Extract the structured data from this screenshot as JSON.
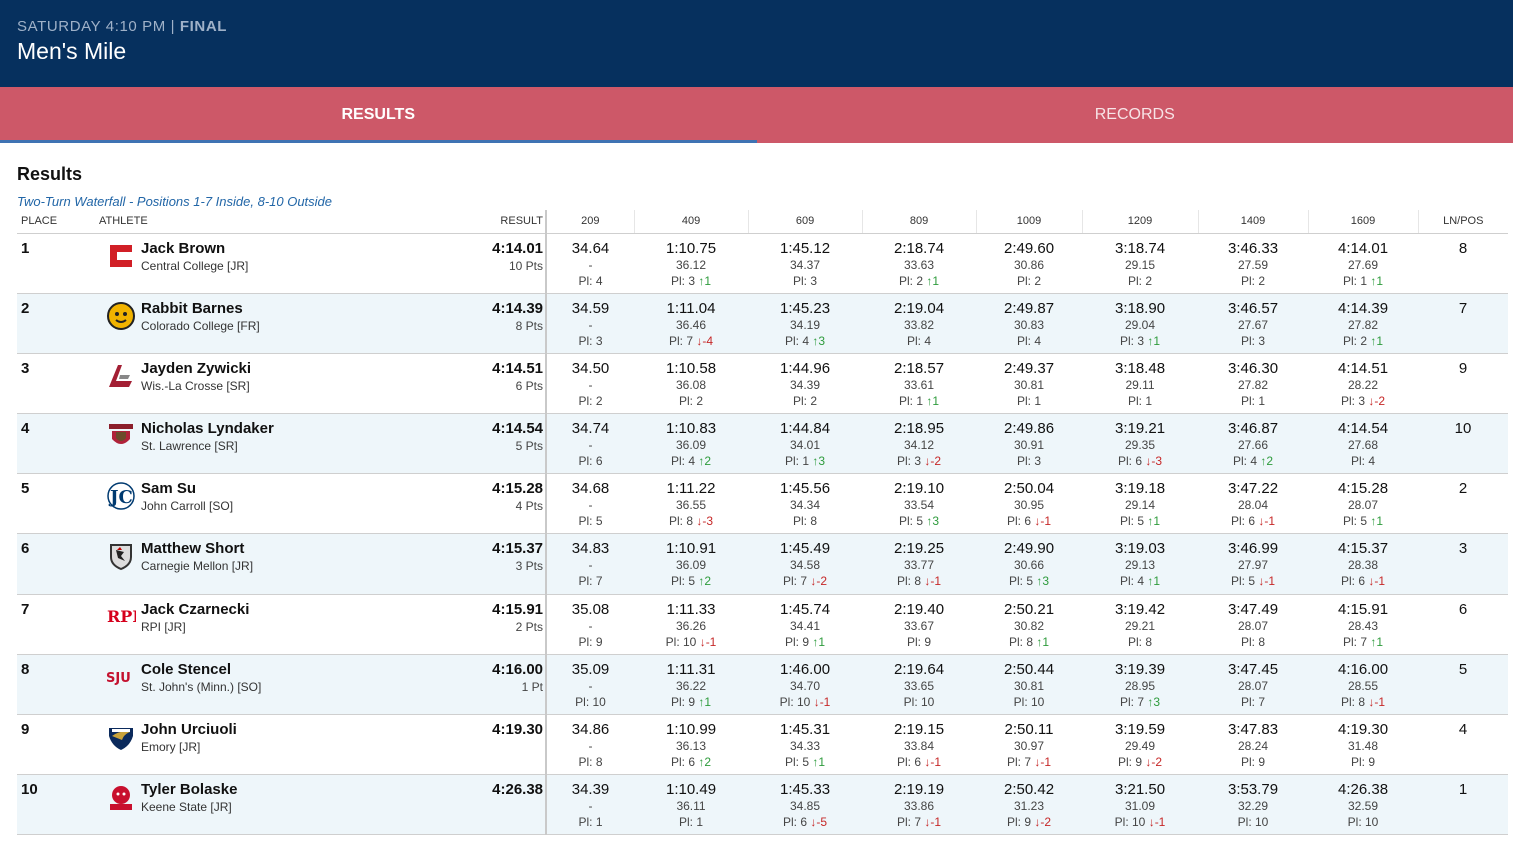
{
  "header": {
    "day_time": "SATURDAY 4:10 PM",
    "separator": "|",
    "status": "FINAL",
    "title": "Men's Mile"
  },
  "tabs": [
    {
      "label": "RESULTS",
      "active": true
    },
    {
      "label": "RECORDS",
      "active": false
    }
  ],
  "results": {
    "title": "Results",
    "subtitle": "Two-Turn Waterfall - Positions 1-7 Inside, 8-10 Outside",
    "columns": {
      "place": "PLACE",
      "athlete": "ATHLETE",
      "result": "RESULT",
      "splits": [
        "209",
        "409",
        "609",
        "809",
        "1009",
        "1209",
        "1409",
        "1609"
      ],
      "lnpos": "LN/POS"
    },
    "rows": [
      {
        "place": "1",
        "name": "Jack Brown",
        "school": "Central College [JR]",
        "logo": "central-college-logo",
        "time": "4:14.01",
        "pts": "10 Pts",
        "ln": "8",
        "splits": [
          {
            "cum": "34.64",
            "lap": "-",
            "pl": "Pl: 4",
            "ch": "",
            "dir": ""
          },
          {
            "cum": "1:10.75",
            "lap": "36.12",
            "pl": "Pl: 3",
            "ch": "↑1",
            "dir": "up"
          },
          {
            "cum": "1:45.12",
            "lap": "34.37",
            "pl": "Pl: 3",
            "ch": "",
            "dir": ""
          },
          {
            "cum": "2:18.74",
            "lap": "33.63",
            "pl": "Pl: 2",
            "ch": "↑1",
            "dir": "up"
          },
          {
            "cum": "2:49.60",
            "lap": "30.86",
            "pl": "Pl: 2",
            "ch": "",
            "dir": ""
          },
          {
            "cum": "3:18.74",
            "lap": "29.15",
            "pl": "Pl: 2",
            "ch": "",
            "dir": ""
          },
          {
            "cum": "3:46.33",
            "lap": "27.59",
            "pl": "Pl: 2",
            "ch": "",
            "dir": ""
          },
          {
            "cum": "4:14.01",
            "lap": "27.69",
            "pl": "Pl: 1",
            "ch": "↑1",
            "dir": "up"
          }
        ]
      },
      {
        "place": "2",
        "name": "Rabbit Barnes",
        "school": "Colorado College [FR]",
        "logo": "colorado-college-logo",
        "time": "4:14.39",
        "pts": "8 Pts",
        "ln": "7",
        "splits": [
          {
            "cum": "34.59",
            "lap": "-",
            "pl": "Pl: 3",
            "ch": "",
            "dir": ""
          },
          {
            "cum": "1:11.04",
            "lap": "36.46",
            "pl": "Pl: 7",
            "ch": "↓-4",
            "dir": "dn"
          },
          {
            "cum": "1:45.23",
            "lap": "34.19",
            "pl": "Pl: 4",
            "ch": "↑3",
            "dir": "up"
          },
          {
            "cum": "2:19.04",
            "lap": "33.82",
            "pl": "Pl: 4",
            "ch": "",
            "dir": ""
          },
          {
            "cum": "2:49.87",
            "lap": "30.83",
            "pl": "Pl: 4",
            "ch": "",
            "dir": ""
          },
          {
            "cum": "3:18.90",
            "lap": "29.04",
            "pl": "Pl: 3",
            "ch": "↑1",
            "dir": "up"
          },
          {
            "cum": "3:46.57",
            "lap": "27.67",
            "pl": "Pl: 3",
            "ch": "",
            "dir": ""
          },
          {
            "cum": "4:14.39",
            "lap": "27.82",
            "pl": "Pl: 2",
            "ch": "↑1",
            "dir": "up"
          }
        ]
      },
      {
        "place": "3",
        "name": "Jayden Zywicki",
        "school": "Wis.-La Crosse [SR]",
        "logo": "wis-la-crosse-logo",
        "time": "4:14.51",
        "pts": "6 Pts",
        "ln": "9",
        "splits": [
          {
            "cum": "34.50",
            "lap": "-",
            "pl": "Pl: 2",
            "ch": "",
            "dir": ""
          },
          {
            "cum": "1:10.58",
            "lap": "36.08",
            "pl": "Pl: 2",
            "ch": "",
            "dir": ""
          },
          {
            "cum": "1:44.96",
            "lap": "34.39",
            "pl": "Pl: 2",
            "ch": "",
            "dir": ""
          },
          {
            "cum": "2:18.57",
            "lap": "33.61",
            "pl": "Pl: 1",
            "ch": "↑1",
            "dir": "up"
          },
          {
            "cum": "2:49.37",
            "lap": "30.81",
            "pl": "Pl: 1",
            "ch": "",
            "dir": ""
          },
          {
            "cum": "3:18.48",
            "lap": "29.11",
            "pl": "Pl: 1",
            "ch": "",
            "dir": ""
          },
          {
            "cum": "3:46.30",
            "lap": "27.82",
            "pl": "Pl: 1",
            "ch": "",
            "dir": ""
          },
          {
            "cum": "4:14.51",
            "lap": "28.22",
            "pl": "Pl: 3",
            "ch": "↓-2",
            "dir": "dn"
          }
        ]
      },
      {
        "place": "4",
        "name": "Nicholas Lyndaker",
        "school": "St. Lawrence [SR]",
        "logo": "st-lawrence-logo",
        "time": "4:14.54",
        "pts": "5 Pts",
        "ln": "10",
        "splits": [
          {
            "cum": "34.74",
            "lap": "-",
            "pl": "Pl: 6",
            "ch": "",
            "dir": ""
          },
          {
            "cum": "1:10.83",
            "lap": "36.09",
            "pl": "Pl: 4",
            "ch": "↑2",
            "dir": "up"
          },
          {
            "cum": "1:44.84",
            "lap": "34.01",
            "pl": "Pl: 1",
            "ch": "↑3",
            "dir": "up"
          },
          {
            "cum": "2:18.95",
            "lap": "34.12",
            "pl": "Pl: 3",
            "ch": "↓-2",
            "dir": "dn"
          },
          {
            "cum": "2:49.86",
            "lap": "30.91",
            "pl": "Pl: 3",
            "ch": "",
            "dir": ""
          },
          {
            "cum": "3:19.21",
            "lap": "29.35",
            "pl": "Pl: 6",
            "ch": "↓-3",
            "dir": "dn"
          },
          {
            "cum": "3:46.87",
            "lap": "27.66",
            "pl": "Pl: 4",
            "ch": "↑2",
            "dir": "up"
          },
          {
            "cum": "4:14.54",
            "lap": "27.68",
            "pl": "Pl: 4",
            "ch": "",
            "dir": ""
          }
        ]
      },
      {
        "place": "5",
        "name": "Sam Su",
        "school": "John Carroll [SO]",
        "logo": "john-carroll-logo",
        "time": "4:15.28",
        "pts": "4 Pts",
        "ln": "2",
        "splits": [
          {
            "cum": "34.68",
            "lap": "-",
            "pl": "Pl: 5",
            "ch": "",
            "dir": ""
          },
          {
            "cum": "1:11.22",
            "lap": "36.55",
            "pl": "Pl: 8",
            "ch": "↓-3",
            "dir": "dn"
          },
          {
            "cum": "1:45.56",
            "lap": "34.34",
            "pl": "Pl: 8",
            "ch": "",
            "dir": ""
          },
          {
            "cum": "2:19.10",
            "lap": "33.54",
            "pl": "Pl: 5",
            "ch": "↑3",
            "dir": "up"
          },
          {
            "cum": "2:50.04",
            "lap": "30.95",
            "pl": "Pl: 6",
            "ch": "↓-1",
            "dir": "dn"
          },
          {
            "cum": "3:19.18",
            "lap": "29.14",
            "pl": "Pl: 5",
            "ch": "↑1",
            "dir": "up"
          },
          {
            "cum": "3:47.22",
            "lap": "28.04",
            "pl": "Pl: 6",
            "ch": "↓-1",
            "dir": "dn"
          },
          {
            "cum": "4:15.28",
            "lap": "28.07",
            "pl": "Pl: 5",
            "ch": "↑1",
            "dir": "up"
          }
        ]
      },
      {
        "place": "6",
        "name": "Matthew Short",
        "school": "Carnegie Mellon [JR]",
        "logo": "carnegie-mellon-logo",
        "time": "4:15.37",
        "pts": "3 Pts",
        "ln": "3",
        "splits": [
          {
            "cum": "34.83",
            "lap": "-",
            "pl": "Pl: 7",
            "ch": "",
            "dir": ""
          },
          {
            "cum": "1:10.91",
            "lap": "36.09",
            "pl": "Pl: 5",
            "ch": "↑2",
            "dir": "up"
          },
          {
            "cum": "1:45.49",
            "lap": "34.58",
            "pl": "Pl: 7",
            "ch": "↓-2",
            "dir": "dn"
          },
          {
            "cum": "2:19.25",
            "lap": "33.77",
            "pl": "Pl: 8",
            "ch": "↓-1",
            "dir": "dn"
          },
          {
            "cum": "2:49.90",
            "lap": "30.66",
            "pl": "Pl: 5",
            "ch": "↑3",
            "dir": "up"
          },
          {
            "cum": "3:19.03",
            "lap": "29.13",
            "pl": "Pl: 4",
            "ch": "↑1",
            "dir": "up"
          },
          {
            "cum": "3:46.99",
            "lap": "27.97",
            "pl": "Pl: 5",
            "ch": "↓-1",
            "dir": "dn"
          },
          {
            "cum": "4:15.37",
            "lap": "28.38",
            "pl": "Pl: 6",
            "ch": "↓-1",
            "dir": "dn"
          }
        ]
      },
      {
        "place": "7",
        "name": "Jack Czarnecki",
        "school": "RPI [JR]",
        "logo": "rpi-logo",
        "time": "4:15.91",
        "pts": "2 Pts",
        "ln": "6",
        "splits": [
          {
            "cum": "35.08",
            "lap": "-",
            "pl": "Pl: 9",
            "ch": "",
            "dir": ""
          },
          {
            "cum": "1:11.33",
            "lap": "36.26",
            "pl": "Pl: 10",
            "ch": "↓-1",
            "dir": "dn"
          },
          {
            "cum": "1:45.74",
            "lap": "34.41",
            "pl": "Pl: 9",
            "ch": "↑1",
            "dir": "up"
          },
          {
            "cum": "2:19.40",
            "lap": "33.67",
            "pl": "Pl: 9",
            "ch": "",
            "dir": ""
          },
          {
            "cum": "2:50.21",
            "lap": "30.82",
            "pl": "Pl: 8",
            "ch": "↑1",
            "dir": "up"
          },
          {
            "cum": "3:19.42",
            "lap": "29.21",
            "pl": "Pl: 8",
            "ch": "",
            "dir": ""
          },
          {
            "cum": "3:47.49",
            "lap": "28.07",
            "pl": "Pl: 8",
            "ch": "",
            "dir": ""
          },
          {
            "cum": "4:15.91",
            "lap": "28.43",
            "pl": "Pl: 7",
            "ch": "↑1",
            "dir": "up"
          }
        ]
      },
      {
        "place": "8",
        "name": "Cole Stencel",
        "school": "St. John's (Minn.) [SO]",
        "logo": "sju-logo",
        "time": "4:16.00",
        "pts": "1 Pt",
        "ln": "5",
        "splits": [
          {
            "cum": "35.09",
            "lap": "-",
            "pl": "Pl: 10",
            "ch": "",
            "dir": ""
          },
          {
            "cum": "1:11.31",
            "lap": "36.22",
            "pl": "Pl: 9",
            "ch": "↑1",
            "dir": "up"
          },
          {
            "cum": "1:46.00",
            "lap": "34.70",
            "pl": "Pl: 10",
            "ch": "↓-1",
            "dir": "dn"
          },
          {
            "cum": "2:19.64",
            "lap": "33.65",
            "pl": "Pl: 10",
            "ch": "",
            "dir": ""
          },
          {
            "cum": "2:50.44",
            "lap": "30.81",
            "pl": "Pl: 10",
            "ch": "",
            "dir": ""
          },
          {
            "cum": "3:19.39",
            "lap": "28.95",
            "pl": "Pl: 7",
            "ch": "↑3",
            "dir": "up"
          },
          {
            "cum": "3:47.45",
            "lap": "28.07",
            "pl": "Pl: 7",
            "ch": "",
            "dir": ""
          },
          {
            "cum": "4:16.00",
            "lap": "28.55",
            "pl": "Pl: 8",
            "ch": "↓-1",
            "dir": "dn"
          }
        ]
      },
      {
        "place": "9",
        "name": "John Urciuoli",
        "school": "Emory [JR]",
        "logo": "emory-logo",
        "time": "4:19.30",
        "pts": "",
        "ln": "4",
        "splits": [
          {
            "cum": "34.86",
            "lap": "-",
            "pl": "Pl: 8",
            "ch": "",
            "dir": ""
          },
          {
            "cum": "1:10.99",
            "lap": "36.13",
            "pl": "Pl: 6",
            "ch": "↑2",
            "dir": "up"
          },
          {
            "cum": "1:45.31",
            "lap": "34.33",
            "pl": "Pl: 5",
            "ch": "↑1",
            "dir": "up"
          },
          {
            "cum": "2:19.15",
            "lap": "33.84",
            "pl": "Pl: 6",
            "ch": "↓-1",
            "dir": "dn"
          },
          {
            "cum": "2:50.11",
            "lap": "30.97",
            "pl": "Pl: 7",
            "ch": "↓-1",
            "dir": "dn"
          },
          {
            "cum": "3:19.59",
            "lap": "29.49",
            "pl": "Pl: 9",
            "ch": "↓-2",
            "dir": "dn"
          },
          {
            "cum": "3:47.83",
            "lap": "28.24",
            "pl": "Pl: 9",
            "ch": "",
            "dir": ""
          },
          {
            "cum": "4:19.30",
            "lap": "31.48",
            "pl": "Pl: 9",
            "ch": "",
            "dir": ""
          }
        ]
      },
      {
        "place": "10",
        "name": "Tyler Bolaske",
        "school": "Keene State [JR]",
        "logo": "keene-state-logo",
        "time": "4:26.38",
        "pts": "",
        "ln": "1",
        "splits": [
          {
            "cum": "34.39",
            "lap": "-",
            "pl": "Pl: 1",
            "ch": "",
            "dir": ""
          },
          {
            "cum": "1:10.49",
            "lap": "36.11",
            "pl": "Pl: 1",
            "ch": "",
            "dir": ""
          },
          {
            "cum": "1:45.33",
            "lap": "34.85",
            "pl": "Pl: 6",
            "ch": "↓-5",
            "dir": "dn"
          },
          {
            "cum": "2:19.19",
            "lap": "33.86",
            "pl": "Pl: 7",
            "ch": "↓-1",
            "dir": "dn"
          },
          {
            "cum": "2:50.42",
            "lap": "31.23",
            "pl": "Pl: 9",
            "ch": "↓-2",
            "dir": "dn"
          },
          {
            "cum": "3:21.50",
            "lap": "31.09",
            "pl": "Pl: 10",
            "ch": "↓-1",
            "dir": "dn"
          },
          {
            "cum": "3:53.79",
            "lap": "32.29",
            "pl": "Pl: 10",
            "ch": "",
            "dir": ""
          },
          {
            "cum": "4:26.38",
            "lap": "32.59",
            "pl": "Pl: 10",
            "ch": "",
            "dir": ""
          }
        ]
      }
    ]
  },
  "colors": {
    "header_bg": "#06305e",
    "tabs_bg": "#cd5868",
    "tab_indicator": "#3f73b3",
    "link": "#2266a7",
    "up": "#2e9b3c",
    "down": "#c62828",
    "row_alt": "#eef6fa"
  }
}
